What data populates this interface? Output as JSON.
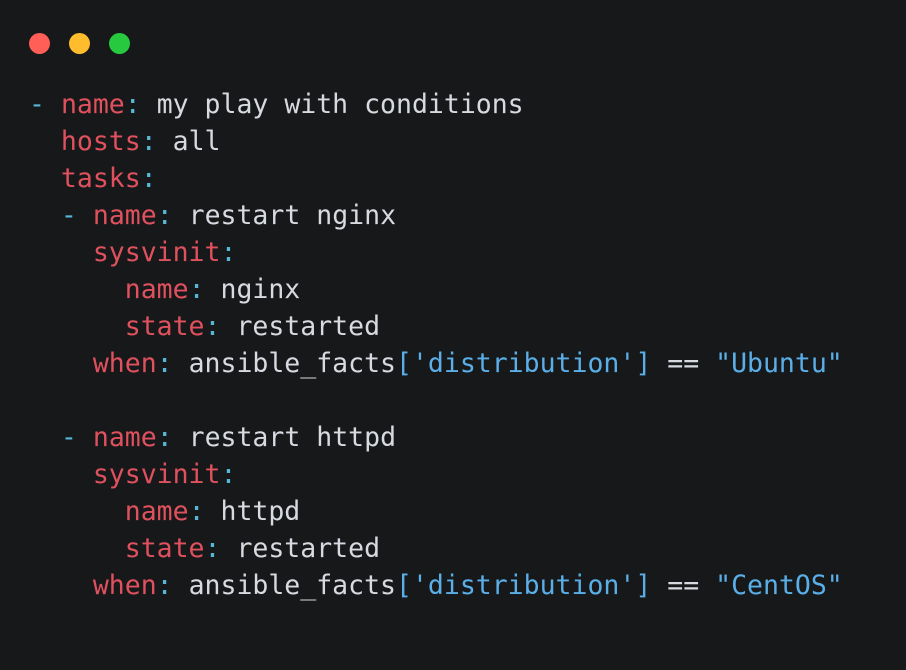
{
  "window": {
    "background_color": "#17181A",
    "traffic_lights": [
      {
        "name": "close",
        "color": "#FF5F56",
        "label": ""
      },
      {
        "name": "minimize",
        "color": "#FFBD2E",
        "label": ""
      },
      {
        "name": "maximize",
        "color": "#27C93F",
        "label": ""
      }
    ]
  },
  "theme": {
    "key_color": "#E0515E",
    "punct_color": "#56B6D6",
    "string_color": "#5BAFE8",
    "text_color": "#D7DAE0",
    "background_color": "#17181A"
  },
  "code": {
    "language": "yaml",
    "plain_text": "- name: my play with conditions\n  hosts: all\n  tasks:\n  - name: restart nginx\n    sysvinit:\n      name: nginx\n      state: restarted\n    when: ansible_facts['distribution'] == \"Ubuntu\"\n\n  - name: restart httpd\n    sysvinit:\n      name: httpd\n      state: restarted\n    when: ansible_facts['distribution'] == \"CentOS\"",
    "lines": [
      {
        "indent": "",
        "tokens": [
          {
            "t": "punct",
            "v": "-"
          },
          {
            "t": "plain",
            "v": " "
          },
          {
            "t": "key",
            "v": "name"
          },
          {
            "t": "punct",
            "v": ":"
          },
          {
            "t": "plain",
            "v": " my play with conditions"
          }
        ]
      },
      {
        "indent": "  ",
        "tokens": [
          {
            "t": "key",
            "v": "hosts"
          },
          {
            "t": "punct",
            "v": ":"
          },
          {
            "t": "plain",
            "v": " all"
          }
        ]
      },
      {
        "indent": "  ",
        "tokens": [
          {
            "t": "key",
            "v": "tasks"
          },
          {
            "t": "punct",
            "v": ":"
          }
        ]
      },
      {
        "indent": "  ",
        "tokens": [
          {
            "t": "punct",
            "v": "-"
          },
          {
            "t": "plain",
            "v": " "
          },
          {
            "t": "key",
            "v": "name"
          },
          {
            "t": "punct",
            "v": ":"
          },
          {
            "t": "plain",
            "v": " restart nginx"
          }
        ]
      },
      {
        "indent": "    ",
        "tokens": [
          {
            "t": "key",
            "v": "sysvinit"
          },
          {
            "t": "punct",
            "v": ":"
          }
        ]
      },
      {
        "indent": "      ",
        "tokens": [
          {
            "t": "key",
            "v": "name"
          },
          {
            "t": "punct",
            "v": ":"
          },
          {
            "t": "plain",
            "v": " nginx"
          }
        ]
      },
      {
        "indent": "      ",
        "tokens": [
          {
            "t": "key",
            "v": "state"
          },
          {
            "t": "punct",
            "v": ":"
          },
          {
            "t": "plain",
            "v": " restarted"
          }
        ]
      },
      {
        "indent": "    ",
        "tokens": [
          {
            "t": "key",
            "v": "when"
          },
          {
            "t": "punct",
            "v": ":"
          },
          {
            "t": "plain",
            "v": " ansible_facts"
          },
          {
            "t": "str",
            "v": "['distribution']"
          },
          {
            "t": "plain",
            "v": " == "
          },
          {
            "t": "str",
            "v": "\"Ubuntu\""
          }
        ]
      },
      {
        "blank": true,
        "indent": "",
        "tokens": []
      },
      {
        "indent": "  ",
        "tokens": [
          {
            "t": "punct",
            "v": "-"
          },
          {
            "t": "plain",
            "v": " "
          },
          {
            "t": "key",
            "v": "name"
          },
          {
            "t": "punct",
            "v": ":"
          },
          {
            "t": "plain",
            "v": " restart httpd"
          }
        ]
      },
      {
        "indent": "    ",
        "tokens": [
          {
            "t": "key",
            "v": "sysvinit"
          },
          {
            "t": "punct",
            "v": ":"
          }
        ]
      },
      {
        "indent": "      ",
        "tokens": [
          {
            "t": "key",
            "v": "name"
          },
          {
            "t": "punct",
            "v": ":"
          },
          {
            "t": "plain",
            "v": " httpd"
          }
        ]
      },
      {
        "indent": "      ",
        "tokens": [
          {
            "t": "key",
            "v": "state"
          },
          {
            "t": "punct",
            "v": ":"
          },
          {
            "t": "plain",
            "v": " restarted"
          }
        ]
      },
      {
        "indent": "    ",
        "tokens": [
          {
            "t": "key",
            "v": "when"
          },
          {
            "t": "punct",
            "v": ":"
          },
          {
            "t": "plain",
            "v": " ansible_facts"
          },
          {
            "t": "str",
            "v": "['distribution']"
          },
          {
            "t": "plain",
            "v": " == "
          },
          {
            "t": "str",
            "v": "\"CentOS\""
          }
        ]
      }
    ]
  }
}
